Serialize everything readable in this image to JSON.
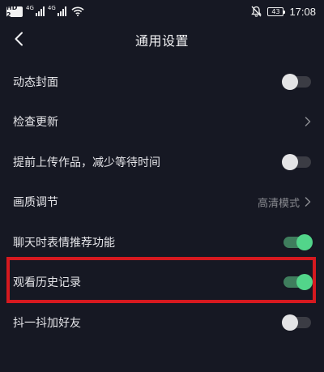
{
  "status_bar": {
    "hd_label": "HD 2",
    "net1": "4G",
    "net2": "4G",
    "battery": "43",
    "time": "17:08",
    "icons": [
      "signal-icon",
      "wifi-icon",
      "mute-icon",
      "battery-icon"
    ]
  },
  "header": {
    "title": "通用设置",
    "back_icon": "chevron-left-icon"
  },
  "settings": [
    {
      "label": "动态封面",
      "control": "toggle",
      "state": "off"
    },
    {
      "label": "检查更新",
      "control": "chevron"
    },
    {
      "label": "提前上传作品，减少等待时间",
      "control": "toggle",
      "state": "off"
    },
    {
      "label": "画质调节",
      "control": "chevron",
      "value": "高清模式"
    },
    {
      "label": "聊天时表情推荐功能",
      "control": "toggle",
      "state": "on"
    },
    {
      "label": "观看历史记录",
      "control": "toggle",
      "state": "on",
      "highlighted": true
    },
    {
      "label": "抖一抖加好友",
      "control": "toggle",
      "state": "off"
    }
  ],
  "colors": {
    "background": "#161823",
    "toggle_on": "#52d58a",
    "highlight": "#d6191f"
  }
}
